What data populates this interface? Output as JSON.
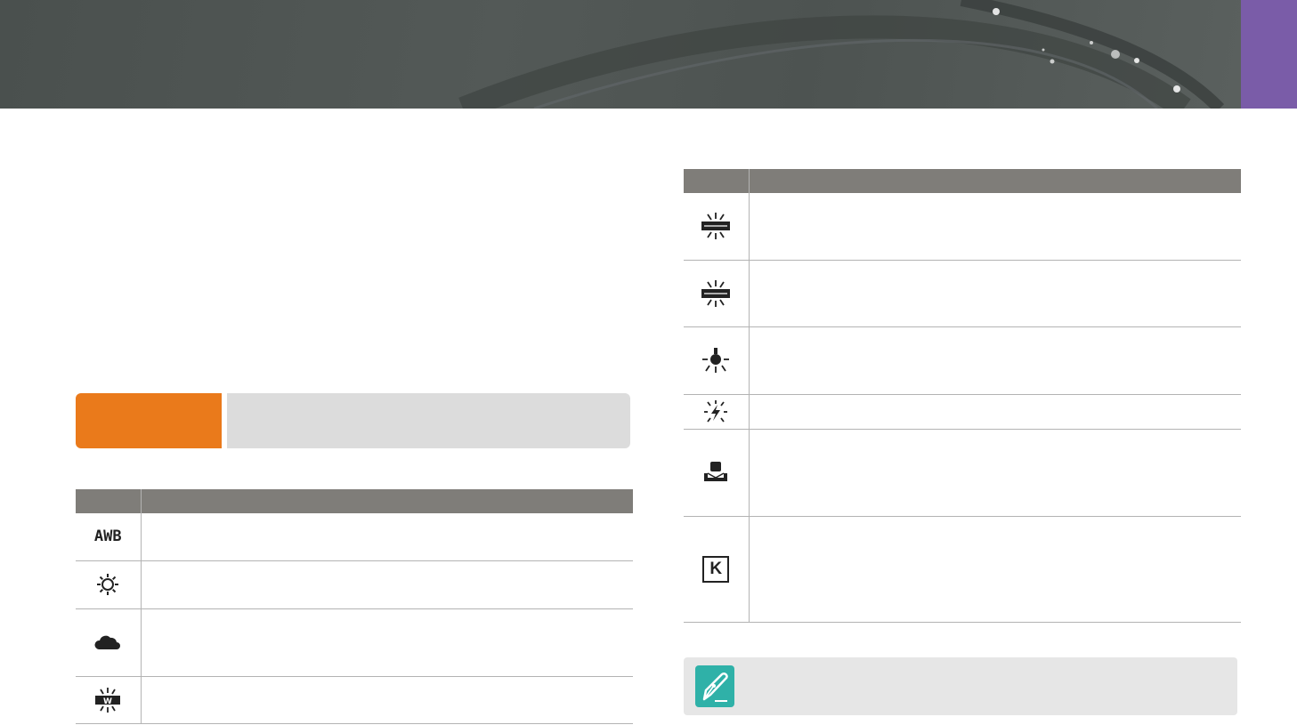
{
  "header": {
    "title": "",
    "chapter_color": "#7a5ca8"
  },
  "left_table": {
    "columns": [
      "",
      ""
    ],
    "rows": [
      {
        "icon": "awb-icon",
        "icon_text": "AWB",
        "desc": ""
      },
      {
        "icon": "daylight-sun-icon",
        "desc": ""
      },
      {
        "icon": "cloudy-icon",
        "desc": ""
      },
      {
        "icon": "fluorescent-white-icon",
        "icon_text": "W",
        "desc": ""
      }
    ]
  },
  "right_table": {
    "columns": [
      "",
      ""
    ],
    "rows": [
      {
        "icon": "fluorescent-nw-icon",
        "desc": ""
      },
      {
        "icon": "fluorescent-d-icon",
        "desc": ""
      },
      {
        "icon": "tungsten-icon",
        "desc": ""
      },
      {
        "icon": "flash-wb-icon",
        "desc": ""
      },
      {
        "icon": "custom-set-icon",
        "desc": ""
      },
      {
        "icon": "color-temperature-k-icon",
        "icon_text": "K",
        "desc": ""
      }
    ]
  },
  "callout": {
    "label": "",
    "text": ""
  },
  "note": {
    "icon": "pen-note-icon",
    "text": ""
  },
  "colors": {
    "orange": "#ea7a1b",
    "teal": "#2fb1a8",
    "table_header": "#7f7d79"
  }
}
